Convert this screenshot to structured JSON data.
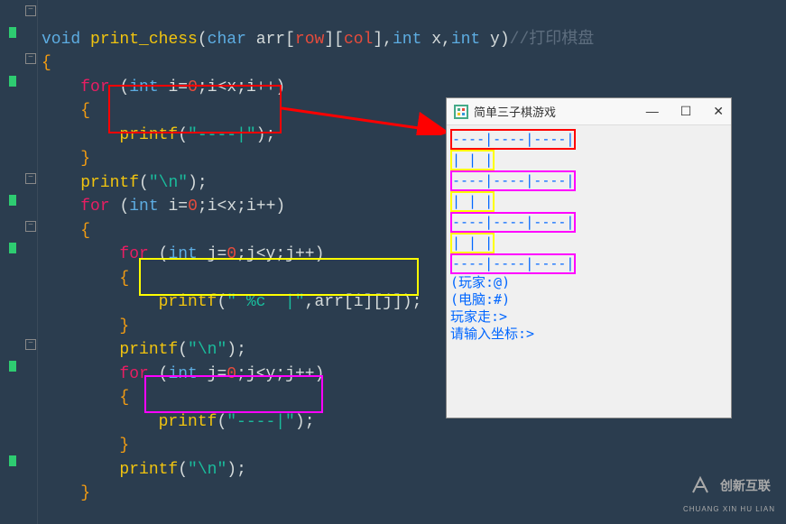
{
  "code": {
    "line1": {
      "void": "void",
      "fn": "print_chess",
      "lparen": "(",
      "char": "char",
      "arr": "arr",
      "lb1": "[",
      "row": "row",
      "rb1": "]",
      "lb2": "[",
      "col": "col",
      "rb2": "]",
      "comma1": ",",
      "int1": "int",
      "x": "x",
      "comma2": ",",
      "int2": "int",
      "y": "y",
      "rparen": ")",
      "comment": "//打印棋盘"
    },
    "line2": "{",
    "line3": {
      "for": "for",
      "lp": "(",
      "int": "int",
      "i": "i",
      "eq": "=",
      "zero": "0",
      "semi1": ";",
      "i2": "i",
      "lt": "<",
      "x": "x",
      "semi2": ";",
      "i3": "i",
      "pp": "++",
      ")": ")"
    },
    "line4": "{",
    "line5": {
      "printf": "printf",
      "lp": "(",
      "str": "\"----|\"",
      "rp": ")",
      "semi": ";"
    },
    "line6": "}",
    "line7": {
      "printf": "printf",
      "lp": "(",
      "str": "\"\\n\"",
      "rp": ")",
      "semi": ";"
    },
    "line8": {
      "for": "for",
      "lp": "(",
      "int": "int",
      "i": "i",
      "eq": "=",
      "zero": "0",
      "semi1": ";",
      "i2": "i",
      "lt": "<",
      "x": "x",
      "semi2": ";",
      "i3": "i",
      "pp": "++",
      ")": ")"
    },
    "line9": "{",
    "line10": {
      "for": "for",
      "lp": "(",
      "int": "int",
      "j": "j",
      "eq": "=",
      "zero": "0",
      "semi1": ";",
      "j2": "j",
      "lt": "<",
      "y": "y",
      "semi2": ";",
      "j3": "j",
      "pp": "++",
      ")": ")"
    },
    "line11": "{",
    "line12": {
      "printf": "printf",
      "lp": "(",
      "str": "\" %c  |\"",
      "comma": ",",
      "arr": "arr",
      "lb1": "[",
      "i": "i",
      "rb1": "]",
      "lb2": "[",
      "j": "j",
      "rb2": "]",
      "rp": ")",
      "semi": ";"
    },
    "line13": "}",
    "line14": {
      "printf": "printf",
      "lp": "(",
      "str": "\"\\n\"",
      "rp": ")",
      "semi": ";"
    },
    "line15": {
      "for": "for",
      "lp": "(",
      "int": "int",
      "j": "j",
      "eq": "=",
      "zero": "0",
      "semi1": ";",
      "j2": "j",
      "lt": "<",
      "y": "y",
      "semi2": ";",
      "j3": "j",
      "pp": "++",
      ")": ")"
    },
    "line16": "{",
    "line17": {
      "printf": "printf",
      "lp": "(",
      "str": "\"----|\"",
      "rp": ")",
      "semi": ";"
    },
    "line18": "}",
    "line19": {
      "printf": "printf",
      "lp": "(",
      "str": "\"\\n\"",
      "rp": ")",
      "semi": ";"
    },
    "line20": "}"
  },
  "output": {
    "title": "简单三子棋游戏",
    "lines": {
      "dashes": "----|----|----|",
      "blanks": "    |    |    |",
      "player": "(玩家:@)",
      "computer": "(电脑:#)",
      "turn": "玩家走:>",
      "coord": "请输入坐标:>"
    },
    "controls": {
      "min": "—",
      "max": "☐",
      "close": "✕"
    }
  },
  "watermark": {
    "name": "创新互联",
    "sub": "CHUANG XIN HU LIAN"
  }
}
